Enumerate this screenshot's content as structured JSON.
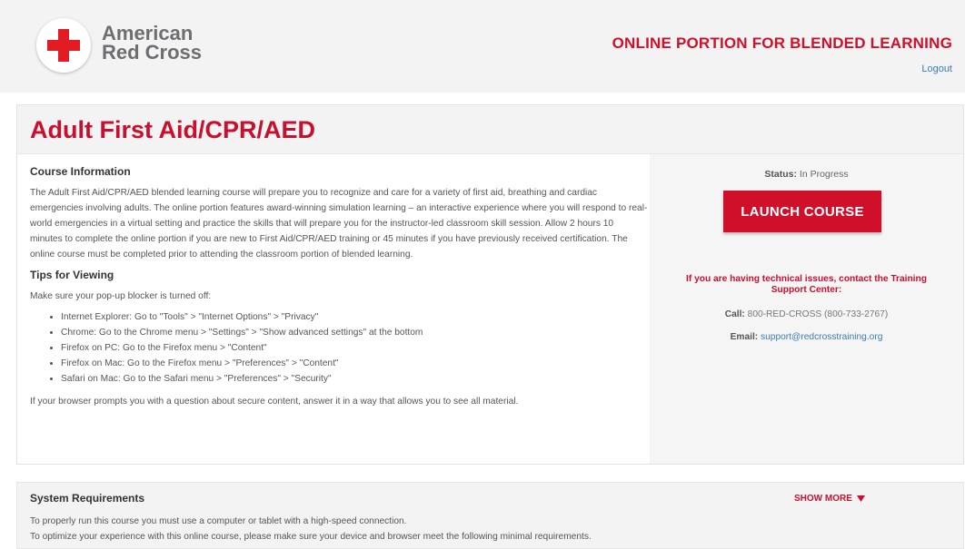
{
  "header": {
    "brand_line1": "American",
    "brand_line2": "Red Cross",
    "portal_title": "ONLINE PORTION FOR BLENDED LEARNING",
    "logout_label": "Logout"
  },
  "course": {
    "title": "Adult First Aid/CPR/AED",
    "info_heading": "Course Information",
    "description": "The Adult First Aid/CPR/AED blended learning course will prepare you to recognize and care for a variety of first aid, breathing and cardiac emergencies involving adults. The online portion features award-winning simulation learning – an interactive experience where you will respond to real-world emergencies in a virtual setting and practice the skills that will prepare you for the instructor-led classroom skill session. Allow 2 hours 10 minutes to complete the online portion if you are new to First Aid/CPR/AED training or 45 minutes if you have previously received certification. The online course must be completed prior to attending the classroom portion of blended learning.",
    "tips_heading": "Tips for Viewing",
    "tips_intro": "Make sure your pop-up blocker is turned off:",
    "tips": [
      "Internet Explorer: Go to \"Tools\" > \"Internet Options\" > \"Privacy\"",
      "Chrome: Go to the Chrome menu > \"Settings\" > \"Show advanced settings\" at the bottom",
      "Firefox on PC: Go to the Firefox menu > \"Content\"",
      "Firefox on Mac: Go to the Firefox menu > \"Preferences\" > \"Content\"",
      "Safari on Mac: Go to the Safari menu > \"Preferences\" > \"Security\""
    ],
    "secure_note": "If your browser prompts you with a question about secure content, answer it in a way that allows you to see all material."
  },
  "sidebar": {
    "status_label": "Status:",
    "status_value": "In Progress",
    "launch_label": "LAUNCH COURSE",
    "tech_issues": "If you are having technical issues, contact the Training Support Center:",
    "call_label": "Call:",
    "call_value": "800-RED-CROSS (800-733-2767)",
    "email_label": "Email:",
    "email_value": "support@redcrosstraining.org"
  },
  "system": {
    "heading": "System Requirements",
    "show_more": "SHOW MORE",
    "line1": "To properly run this course you must use a computer or tablet with a high-speed connection.",
    "line2": "To optimize your experience with this online course, please make sure your device and browser meet the following minimal requirements."
  },
  "colors": {
    "brand_red": "#c8102e",
    "link_blue": "#3e7bb3",
    "header_gray": "#f3f3f3"
  },
  "icons": {
    "logo": "red-cross-icon",
    "show_more": "triangle-down-icon"
  }
}
